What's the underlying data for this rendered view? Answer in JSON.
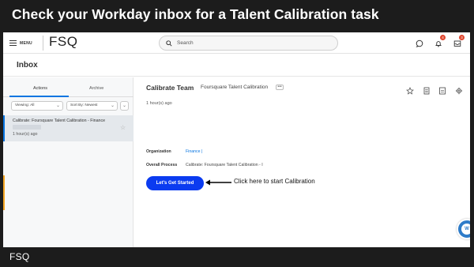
{
  "banner": {
    "title": "Check your Workday inbox for a Talent Calibration task"
  },
  "footer": {
    "logo": "FSQ"
  },
  "topbar": {
    "menu_label": "MENU",
    "brand": "FSQ",
    "search_placeholder": "Search",
    "notifications_count": "4",
    "inbox_count": "3"
  },
  "page": {
    "title": "Inbox"
  },
  "left": {
    "tabs": [
      "Actions",
      "Archive"
    ],
    "filter_viewing": "Viewing: All",
    "filter_sort": "Sort By: Newest",
    "item": {
      "title": "Calibrate: Foursquare Talent Calibration - Finance",
      "time": "1 hour(s) ago"
    }
  },
  "detail": {
    "title": "Calibrate Team",
    "subtitle": "Foursquare Talent Calibration",
    "more": "•••",
    "time": "1 hour(s) ago",
    "organization_label": "Organization",
    "organization_value": "Finance |",
    "process_label": "Overall Process",
    "process_value": "Calibrate: Foursquare Talent Calibration - I",
    "cta": "Let's Get Started",
    "annotation": "Click here to start Calibration"
  },
  "help": {
    "label": "W"
  },
  "colors": {
    "accent": "#0875e1",
    "cta": "#0b3bf0",
    "badge": "#e0472f"
  }
}
